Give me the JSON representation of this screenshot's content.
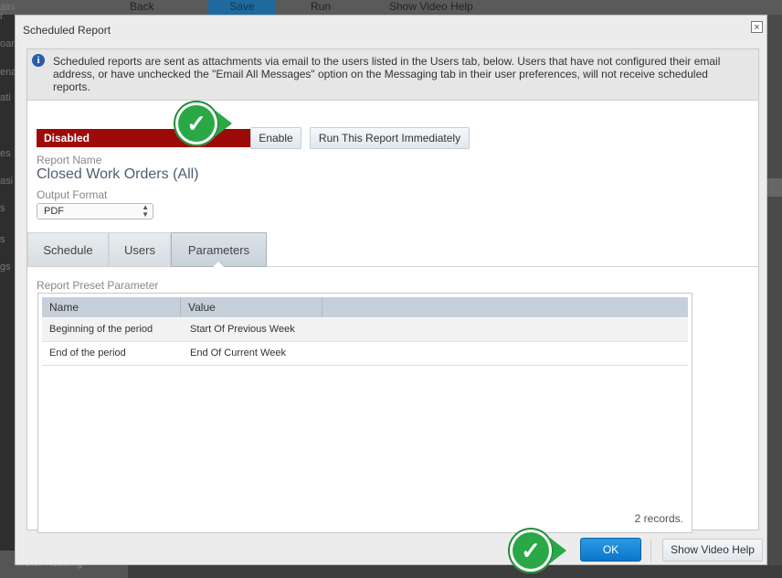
{
  "background": {
    "toolbar": {
      "back": "Back",
      "save": "Save",
      "run": "Run",
      "video_help": "Show Video Help"
    },
    "sidebar_fragments": [
      "aining",
      "r",
      "oar",
      "ena",
      "ati",
      "es",
      "asi",
      "s",
      "s",
      "gs"
    ],
    "bottom_left": "Meter Reading"
  },
  "dialog": {
    "title": "Scheduled Report",
    "close_glyph": "×",
    "info_icon_glyph": "i",
    "info_text": "Scheduled reports are sent as attachments via email to the users listed in the Users tab, below. Users that have not configured their email address, or have unchecked the \"Email All Messages\" option on the Messaging tab in their user preferences, will not receive scheduled reports.",
    "status_badge": "Disabled",
    "enable_button": "Enable",
    "run_button": "Run This Report Immediately",
    "report_name_label": "Report Name",
    "report_name": "Closed Work Orders (All)",
    "output_format_label": "Output Format",
    "output_format_value": "PDF",
    "tabs": [
      {
        "label": "Schedule",
        "active": false
      },
      {
        "label": "Users",
        "active": false
      },
      {
        "label": "Parameters",
        "active": true
      }
    ],
    "preset_label": "Report Preset Parameter",
    "grid": {
      "columns": [
        "Name",
        "Value"
      ],
      "rows": [
        [
          "Beginning of the period",
          "Start Of Previous Week"
        ],
        [
          "End of the period",
          "End Of Current Week"
        ]
      ],
      "record_count": "2 records."
    },
    "ok_button": "OK",
    "video_help_button": "Show Video Help"
  },
  "annotations": {
    "check_glyph": "✓",
    "color": "#29a845"
  },
  "colors": {
    "disabled": "#9d0a0a",
    "primary": "#0b76c9",
    "tab_active": "#c9d1d8"
  }
}
